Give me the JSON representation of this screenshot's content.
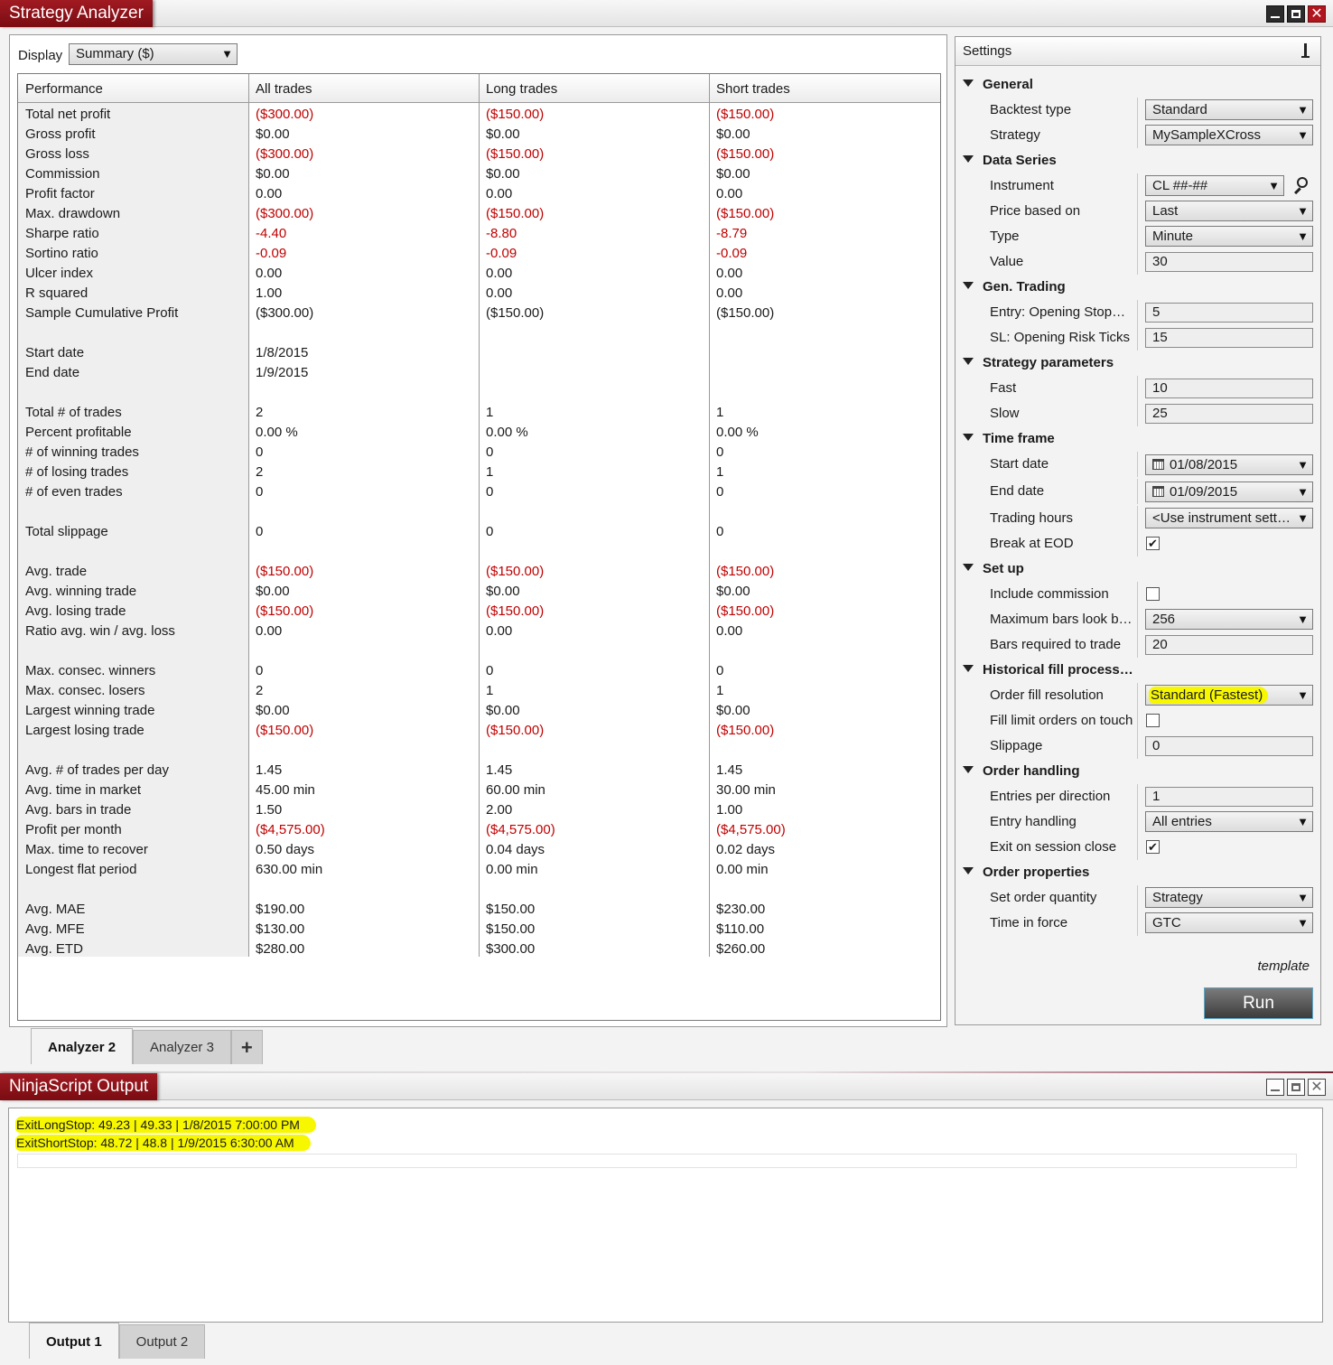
{
  "analyzer": {
    "title": "Strategy Analyzer",
    "display_label": "Display",
    "display_value": "Summary ($)",
    "columns": [
      "Performance",
      "All trades",
      "Long trades",
      "Short trades"
    ],
    "rows": [
      {
        "label": "Total net profit",
        "all": "($300.00)",
        "long": "($150.00)",
        "short": "($150.00)",
        "neg": [
          true,
          true,
          true
        ]
      },
      {
        "label": "Gross profit",
        "all": "$0.00",
        "long": "$0.00",
        "short": "$0.00",
        "neg": [
          false,
          false,
          false
        ]
      },
      {
        "label": "Gross loss",
        "all": "($300.00)",
        "long": "($150.00)",
        "short": "($150.00)",
        "neg": [
          true,
          true,
          true
        ]
      },
      {
        "label": "Commission",
        "all": "$0.00",
        "long": "$0.00",
        "short": "$0.00",
        "neg": [
          false,
          false,
          false
        ]
      },
      {
        "label": "Profit factor",
        "all": "0.00",
        "long": "0.00",
        "short": "0.00",
        "neg": [
          false,
          false,
          false
        ]
      },
      {
        "label": "Max. drawdown",
        "all": "($300.00)",
        "long": "($150.00)",
        "short": "($150.00)",
        "neg": [
          true,
          true,
          true
        ]
      },
      {
        "label": "Sharpe ratio",
        "all": "-4.40",
        "long": "-8.80",
        "short": "-8.79",
        "neg": [
          true,
          true,
          true
        ]
      },
      {
        "label": "Sortino ratio",
        "all": "-0.09",
        "long": "-0.09",
        "short": "-0.09",
        "neg": [
          true,
          true,
          true
        ]
      },
      {
        "label": "Ulcer index",
        "all": "0.00",
        "long": "0.00",
        "short": "0.00",
        "neg": [
          false,
          false,
          false
        ]
      },
      {
        "label": "R squared",
        "all": "1.00",
        "long": "0.00",
        "short": "0.00",
        "neg": [
          false,
          false,
          false
        ]
      },
      {
        "label": "Sample Cumulative Profit",
        "all": "($300.00)",
        "long": "($150.00)",
        "short": "($150.00)",
        "neg": [
          false,
          false,
          false
        ]
      },
      {
        "label": "",
        "all": "",
        "long": "",
        "short": "",
        "neg": [
          false,
          false,
          false
        ]
      },
      {
        "label": "Start date",
        "all": "1/8/2015",
        "long": "",
        "short": "",
        "neg": [
          false,
          false,
          false
        ]
      },
      {
        "label": "End date",
        "all": "1/9/2015",
        "long": "",
        "short": "",
        "neg": [
          false,
          false,
          false
        ]
      },
      {
        "label": "",
        "all": "",
        "long": "",
        "short": "",
        "neg": [
          false,
          false,
          false
        ]
      },
      {
        "label": "Total # of trades",
        "all": "2",
        "long": "1",
        "short": "1",
        "neg": [
          false,
          false,
          false
        ]
      },
      {
        "label": "Percent profitable",
        "all": "0.00 %",
        "long": "0.00 %",
        "short": "0.00 %",
        "neg": [
          false,
          false,
          false
        ]
      },
      {
        "label": "# of winning trades",
        "all": "0",
        "long": "0",
        "short": "0",
        "neg": [
          false,
          false,
          false
        ]
      },
      {
        "label": "# of losing trades",
        "all": "2",
        "long": "1",
        "short": "1",
        "neg": [
          false,
          false,
          false
        ]
      },
      {
        "label": "# of even trades",
        "all": "0",
        "long": "0",
        "short": "0",
        "neg": [
          false,
          false,
          false
        ]
      },
      {
        "label": "",
        "all": "",
        "long": "",
        "short": "",
        "neg": [
          false,
          false,
          false
        ]
      },
      {
        "label": "Total slippage",
        "all": "0",
        "long": "0",
        "short": "0",
        "neg": [
          false,
          false,
          false
        ]
      },
      {
        "label": "",
        "all": "",
        "long": "",
        "short": "",
        "neg": [
          false,
          false,
          false
        ]
      },
      {
        "label": "Avg. trade",
        "all": "($150.00)",
        "long": "($150.00)",
        "short": "($150.00)",
        "neg": [
          true,
          true,
          true
        ]
      },
      {
        "label": "Avg. winning trade",
        "all": "$0.00",
        "long": "$0.00",
        "short": "$0.00",
        "neg": [
          false,
          false,
          false
        ]
      },
      {
        "label": "Avg. losing trade",
        "all": "($150.00)",
        "long": "($150.00)",
        "short": "($150.00)",
        "neg": [
          true,
          true,
          true
        ]
      },
      {
        "label": "Ratio avg. win / avg. loss",
        "all": "0.00",
        "long": "0.00",
        "short": "0.00",
        "neg": [
          false,
          false,
          false
        ]
      },
      {
        "label": "",
        "all": "",
        "long": "",
        "short": "",
        "neg": [
          false,
          false,
          false
        ]
      },
      {
        "label": "Max. consec. winners",
        "all": "0",
        "long": "0",
        "short": "0",
        "neg": [
          false,
          false,
          false
        ]
      },
      {
        "label": "Max. consec. losers",
        "all": "2",
        "long": "1",
        "short": "1",
        "neg": [
          false,
          false,
          false
        ]
      },
      {
        "label": "Largest winning trade",
        "all": "$0.00",
        "long": "$0.00",
        "short": "$0.00",
        "neg": [
          false,
          false,
          false
        ]
      },
      {
        "label": "Largest losing trade",
        "all": "($150.00)",
        "long": "($150.00)",
        "short": "($150.00)",
        "neg": [
          true,
          true,
          true
        ]
      },
      {
        "label": "",
        "all": "",
        "long": "",
        "short": "",
        "neg": [
          false,
          false,
          false
        ]
      },
      {
        "label": "Avg. # of trades per day",
        "all": "1.45",
        "long": "1.45",
        "short": "1.45",
        "neg": [
          false,
          false,
          false
        ]
      },
      {
        "label": "Avg. time in market",
        "all": "45.00 min",
        "long": "60.00 min",
        "short": "30.00 min",
        "neg": [
          false,
          false,
          false
        ]
      },
      {
        "label": "Avg. bars in trade",
        "all": "1.50",
        "long": "2.00",
        "short": "1.00",
        "neg": [
          false,
          false,
          false
        ]
      },
      {
        "label": "Profit per month",
        "all": "($4,575.00)",
        "long": "($4,575.00)",
        "short": "($4,575.00)",
        "neg": [
          true,
          true,
          true
        ]
      },
      {
        "label": "Max. time to recover",
        "all": "0.50 days",
        "long": "0.04 days",
        "short": "0.02 days",
        "neg": [
          false,
          false,
          false
        ]
      },
      {
        "label": "Longest flat period",
        "all": "630.00 min",
        "long": "0.00 min",
        "short": "0.00 min",
        "neg": [
          false,
          false,
          false
        ]
      },
      {
        "label": "",
        "all": "",
        "long": "",
        "short": "",
        "neg": [
          false,
          false,
          false
        ]
      },
      {
        "label": "Avg. MAE",
        "all": "$190.00",
        "long": "$150.00",
        "short": "$230.00",
        "neg": [
          false,
          false,
          false
        ]
      },
      {
        "label": "Avg. MFE",
        "all": "$130.00",
        "long": "$150.00",
        "short": "$110.00",
        "neg": [
          false,
          false,
          false
        ]
      },
      {
        "label": "Avg. ETD",
        "all": "$280.00",
        "long": "$300.00",
        "short": "$260.00",
        "neg": [
          false,
          false,
          false
        ]
      }
    ],
    "tabs": [
      "Analyzer 2",
      "Analyzer 3"
    ],
    "add_tab_label": "+"
  },
  "settings": {
    "title": "Settings",
    "template_label": "template",
    "run_label": "Run",
    "categories": [
      {
        "name": "General",
        "items": [
          {
            "label": "Backtest type",
            "type": "combo",
            "value": "Standard"
          },
          {
            "label": "Strategy",
            "type": "combo",
            "value": "MySampleXCross"
          }
        ]
      },
      {
        "name": "Data Series",
        "items": [
          {
            "label": "Instrument",
            "type": "instrument",
            "value": "CL ##-##"
          },
          {
            "label": "Price based on",
            "type": "combo",
            "value": "Last"
          },
          {
            "label": "Type",
            "type": "combo",
            "value": "Minute"
          },
          {
            "label": "Value",
            "type": "text",
            "value": "30"
          }
        ]
      },
      {
        "name": "Gen. Trading",
        "items": [
          {
            "label": "Entry: Opening Stop…",
            "type": "text",
            "value": "5"
          },
          {
            "label": "SL: Opening Risk Ticks",
            "type": "text",
            "value": "15"
          }
        ]
      },
      {
        "name": "Strategy parameters",
        "items": [
          {
            "label": "Fast",
            "type": "text",
            "value": "10"
          },
          {
            "label": "Slow",
            "type": "text",
            "value": "25"
          }
        ]
      },
      {
        "name": "Time frame",
        "items": [
          {
            "label": "Start date",
            "type": "date",
            "value": "01/08/2015"
          },
          {
            "label": "End date",
            "type": "date",
            "value": "01/09/2015"
          },
          {
            "label": "Trading hours",
            "type": "combo",
            "value": "<Use instrument sett…"
          },
          {
            "label": "Break at EOD",
            "type": "check",
            "checked": true
          }
        ]
      },
      {
        "name": "Set up",
        "items": [
          {
            "label": "Include commission",
            "type": "check",
            "checked": false
          },
          {
            "label": "Maximum bars look b…",
            "type": "combo",
            "value": "256"
          },
          {
            "label": "Bars required to trade",
            "type": "text",
            "value": "20"
          }
        ]
      },
      {
        "name": "Historical fill process…",
        "items": [
          {
            "label": "Order fill resolution",
            "type": "combo",
            "value": "Standard (Fastest)",
            "highlight": true
          },
          {
            "label": "Fill limit orders on touch",
            "type": "check",
            "checked": false
          },
          {
            "label": "Slippage",
            "type": "text",
            "value": "0"
          }
        ]
      },
      {
        "name": "Order handling",
        "items": [
          {
            "label": "Entries per direction",
            "type": "text",
            "value": "1"
          },
          {
            "label": "Entry handling",
            "type": "combo",
            "value": "All entries"
          },
          {
            "label": "Exit on session close",
            "type": "check",
            "checked": true
          }
        ]
      },
      {
        "name": "Order properties",
        "items": [
          {
            "label": "Set order quantity",
            "type": "combo",
            "value": "Strategy"
          },
          {
            "label": "Time in force",
            "type": "combo",
            "value": "GTC"
          }
        ]
      }
    ]
  },
  "output": {
    "title": "NinjaScript Output",
    "lines": [
      "ExitLongStop: 49.23 | 49.33 | 1/8/2015 7:00:00 PM",
      "ExitShortStop: 48.72 | 48.8 | 1/9/2015 6:30:00 AM"
    ],
    "tabs": [
      "Output 1",
      "Output 2"
    ]
  },
  "colors": {
    "title_red": "#a11a22",
    "negative": "#c00000",
    "highlight": "#f7f700"
  }
}
